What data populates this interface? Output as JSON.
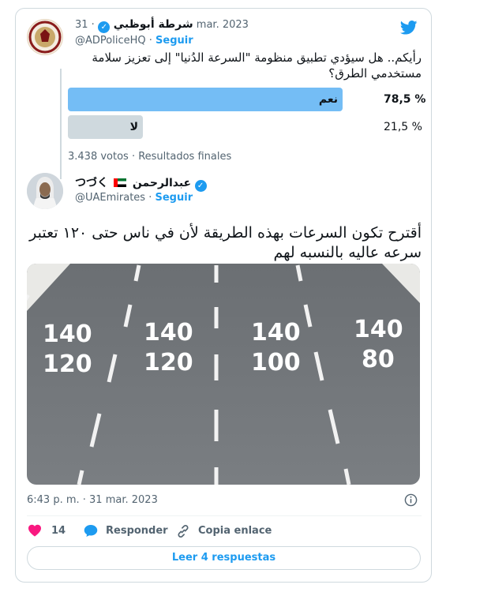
{
  "poll_tweet": {
    "author_name": "شرطة أبوظبي",
    "handle": "@ADPoliceHQ",
    "follow_label": "Seguir",
    "date": "· 31 mar. 2023",
    "text": "رأيكم.. هل سيؤدي تطبيق منظومة \"السرعة الدُنيا\" إلى تعزيز سلامة مستخدمي الطرق؟",
    "options": [
      {
        "label": "نعم",
        "percent_text": "78,5 %",
        "fraction": 0.785
      },
      {
        "label": "لا",
        "percent_text": "21,5 %",
        "fraction": 0.215
      }
    ],
    "votes_summary": "3.438 votos · Resultados finales"
  },
  "reply_tweet": {
    "author_name": "عبدالرحمن",
    "name_suffix": "つづく",
    "flag_icon": "uae-flag-icon",
    "handle": "@UAEmirates",
    "follow_label": "Seguir",
    "text": "أقترح تكون السرعات بهذه الطريقة لأن في ناس حتى ١٢٠ تعتبر سرعه عاليه بالنسبه لهم",
    "image_lanes": [
      {
        "top": "140",
        "bottom": "120"
      },
      {
        "top": "140",
        "bottom": "120"
      },
      {
        "top": "140",
        "bottom": "100"
      },
      {
        "top": "140",
        "bottom": "80"
      }
    ],
    "timestamp": "6:43 p. m. · 31 mar. 2023",
    "like_count": "14",
    "reply_label": "Responder",
    "copy_link_label": "Copia enlace",
    "read_replies_label": "Leer 4 respuestas"
  },
  "colors": {
    "twitter_blue": "#1d9bf0",
    "poll_winner": "#74bdf5",
    "poll_other": "#cfd9de",
    "like_pink": "#f91880"
  }
}
